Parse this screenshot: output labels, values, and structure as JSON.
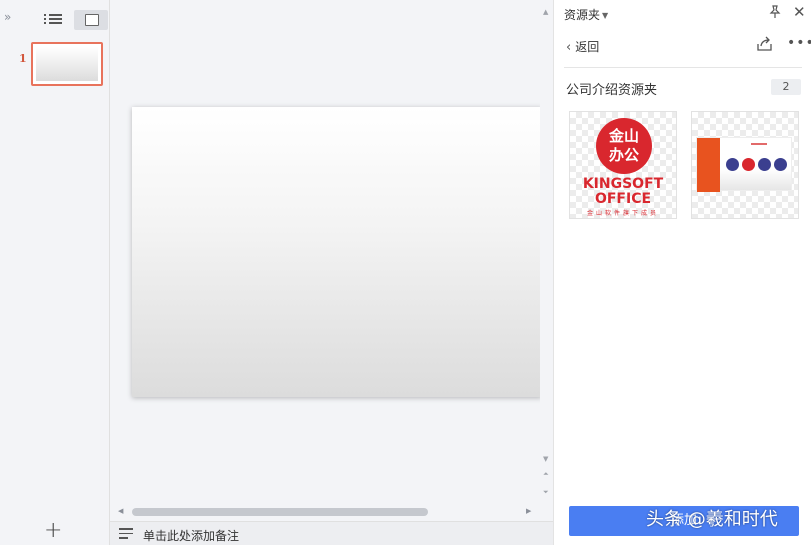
{
  "thumbnails": {
    "slides": [
      {
        "number": "1"
      }
    ]
  },
  "notes_bar": {
    "placeholder": "单击此处添加备注"
  },
  "resource_panel": {
    "title": "资源夹",
    "back_label": "返回",
    "folder_name": "公司介绍资源夹",
    "folder_count": "2",
    "logo": {
      "circle_text_top": "金山",
      "circle_text_bottom": "办公",
      "line1": "KINGSOFT",
      "line2": "OFFICE",
      "slogan": "金山软件旗下成员"
    },
    "add_button_label": "添加"
  },
  "watermark": "头条 @羲和时代",
  "colors": {
    "accent": "#4a7ef2",
    "selection": "#e8735c",
    "brand_red": "#d9272e"
  }
}
